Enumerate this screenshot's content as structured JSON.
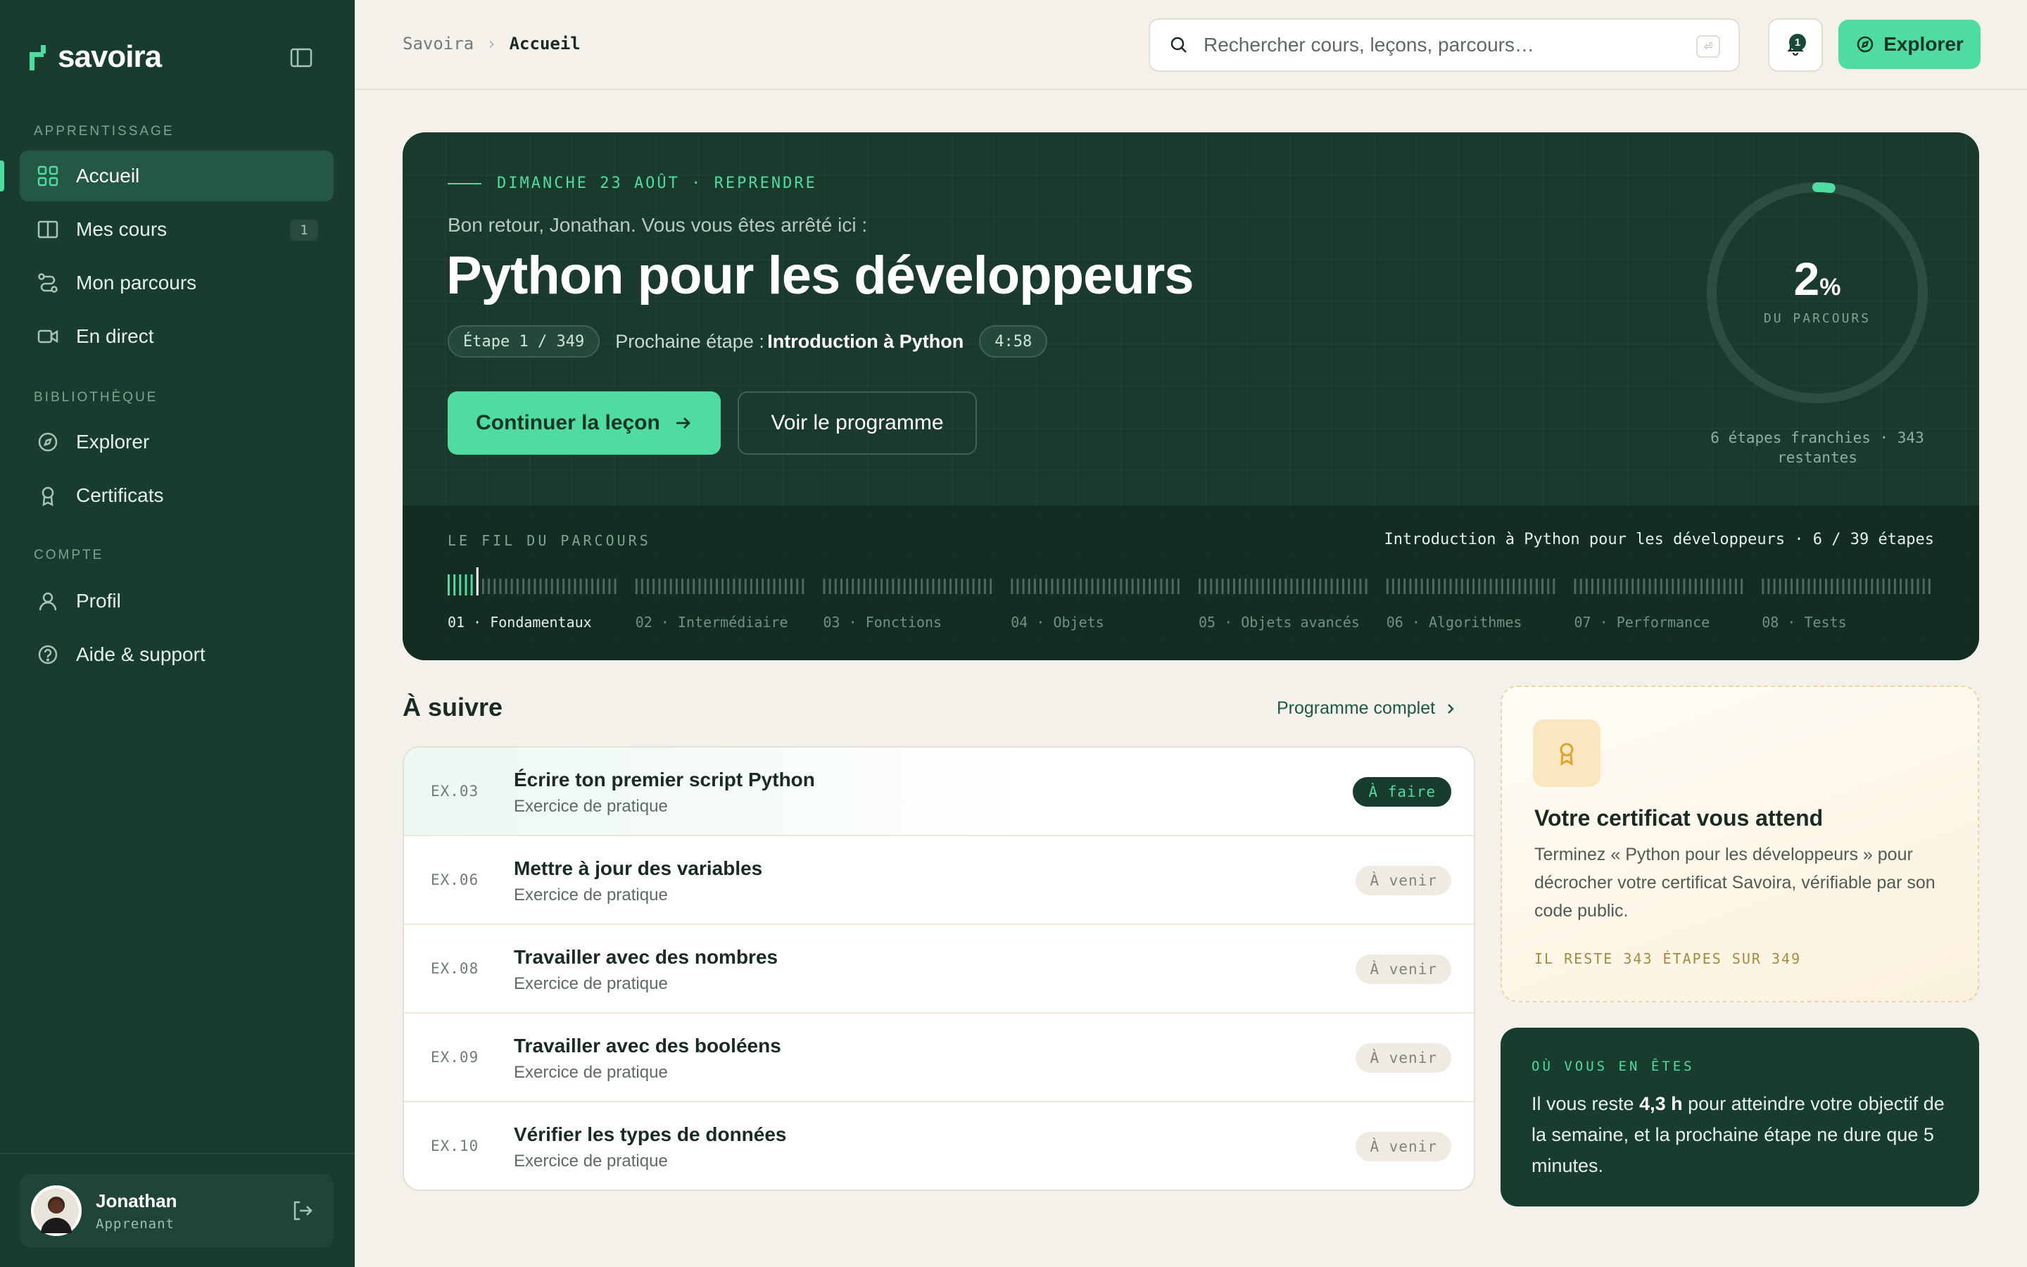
{
  "brand": {
    "name": "savoira"
  },
  "sidebar": {
    "sections": {
      "learning": "APPRENTISSAGE",
      "library": "BIBLIOTHÈQUE",
      "account": "COMPTE"
    },
    "items": [
      {
        "label": "Accueil",
        "icon": "grid-icon",
        "active": true
      },
      {
        "label": "Mes cours",
        "icon": "book-icon",
        "badge": "1"
      },
      {
        "label": "Mon parcours",
        "icon": "route-icon"
      },
      {
        "label": "En direct",
        "icon": "video-icon"
      },
      {
        "label": "Explorer",
        "icon": "compass-icon"
      },
      {
        "label": "Certificats",
        "icon": "award-icon"
      },
      {
        "label": "Profil",
        "icon": "user-icon"
      },
      {
        "label": "Aide & support",
        "icon": "help-icon"
      }
    ],
    "user": {
      "name": "Jonathan",
      "role": "Apprenant"
    }
  },
  "topbar": {
    "breadcrumb": [
      "Savoira",
      "Accueil"
    ],
    "search_placeholder": "Rechercher cours, leçons, parcours…",
    "search_kbd": "⏎",
    "notif_count": "1",
    "explore_label": "Explorer"
  },
  "hero": {
    "eyebrow": "DIMANCHE 23 AOÛT · REPRENDRE",
    "subtitle": "Bon retour, Jonathan. Vous vous êtes arrêté ici :",
    "title": "Python pour les développeurs",
    "step_pill": "Étape 1 / 349",
    "next_label": "Prochaine étape :",
    "next_value": "Introduction à Python",
    "duration_pill": "4:58",
    "primary_button": "Continuer la leçon",
    "secondary_button": "Voir le programme",
    "progress": {
      "value": "2",
      "unit": "%",
      "fraction": 0.02,
      "label": "DU PARCOURS"
    },
    "progress_caption": "6 étapes franchies · 343 restantes",
    "track": {
      "label": "LE FIL DU PARCOURS",
      "info": "Introduction à Python pour les développeurs · 6 / 39 étapes",
      "modules": [
        "01 · Fondamentaux",
        "02 · Intermédiaire",
        "03 · Fonctions",
        "04 · Objets",
        "05 · Objets avancés",
        "06 · Algorithmes",
        "07 · Performance",
        "08 · Tests"
      ],
      "completed_steps": 6,
      "current_module": 0
    }
  },
  "next_up": {
    "title": "À suivre",
    "link": "Programme complet",
    "items": [
      {
        "code": "EX.03",
        "title": "Écrire ton premier script Python",
        "sub": "Exercice de pratique",
        "status": "À faire"
      },
      {
        "code": "EX.06",
        "title": "Mettre à jour des variables",
        "sub": "Exercice de pratique",
        "status": "À venir"
      },
      {
        "code": "EX.08",
        "title": "Travailler avec des nombres",
        "sub": "Exercice de pratique",
        "status": "À venir"
      },
      {
        "code": "EX.09",
        "title": "Travailler avec des booléens",
        "sub": "Exercice de pratique",
        "status": "À venir"
      },
      {
        "code": "EX.10",
        "title": "Vérifier les types de données",
        "sub": "Exercice de pratique",
        "status": "À venir"
      }
    ]
  },
  "certificate": {
    "title": "Votre certificat vous attend",
    "body": "Terminez « Python pour les développeurs » pour décrocher votre certificat Savoira, vérifiable par son code public.",
    "footer": "IL RESTE 343 ÉTAPES SUR 349"
  },
  "where": {
    "label": "OÙ VOUS EN ÊTES",
    "text_1": "Il vous reste ",
    "text_bold": "4,3 h",
    "text_2": " pour atteindre votre objectif de la semaine, et la prochaine étape ne dure que 5 minutes."
  },
  "colors": {
    "sidebar": "#183c2e",
    "accent": "#4fdca0",
    "page": "#f4f1ea"
  }
}
